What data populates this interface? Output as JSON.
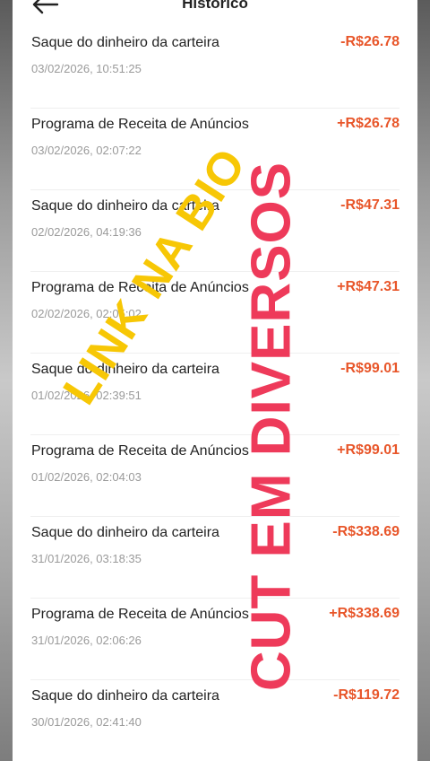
{
  "header": {
    "title": "Histórico"
  },
  "transactions": [
    {
      "name": "Saque do dinheiro da carteira",
      "date": "03/02/2026, 10:51:25",
      "amount": "-R$26.78"
    },
    {
      "name": "Programa de Receita de Anúncios",
      "date": "03/02/2026, 02:07:22",
      "amount": "+R$26.78"
    },
    {
      "name": "Saque do dinheiro da carteira",
      "date": "02/02/2026, 04:19:36",
      "amount": "-R$47.31"
    },
    {
      "name": "Programa de Receita de Anúncios",
      "date": "02/02/2026, 02:05:02",
      "amount": "+R$47.31"
    },
    {
      "name": "Saque do dinheiro da carteira",
      "date": "01/02/2026, 02:39:51",
      "amount": "-R$99.01"
    },
    {
      "name": "Programa de Receita de Anúncios",
      "date": "01/02/2026, 02:04:03",
      "amount": "+R$99.01"
    },
    {
      "name": "Saque do dinheiro da carteira",
      "date": "31/01/2026, 03:18:35",
      "amount": "-R$338.69"
    },
    {
      "name": "Programa de Receita de Anúncios",
      "date": "31/01/2026, 02:06:26",
      "amount": "+R$338.69"
    },
    {
      "name": "Saque do dinheiro da carteira",
      "date": "30/01/2026, 02:41:40",
      "amount": "-R$119.72"
    }
  ],
  "overlays": {
    "yellow_text": "LINK NA BIO",
    "red_text": "CUT EM DIVERSOS"
  },
  "colors": {
    "amount": "#e8562a",
    "overlay_yellow": "#f7c705",
    "overlay_red": "#ee3a5a"
  }
}
